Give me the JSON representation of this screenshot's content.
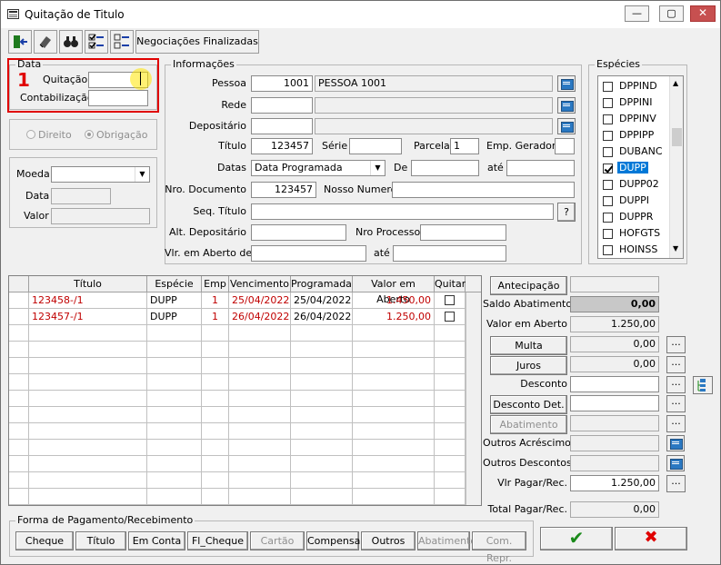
{
  "window": {
    "title": "Quitação de Titulo",
    "minimize": "—",
    "maximize": "▢",
    "close": "✕"
  },
  "toolbar": {
    "negociacoes_label": "Negociações Finalizadas"
  },
  "annotation": {
    "step": "1"
  },
  "data_group": {
    "caption": "Data",
    "quitacao_label": "Quitação",
    "quitacao_value": "",
    "contabilizacao_label": "Contabilização",
    "contabilizacao_value": ""
  },
  "tipo": {
    "direito": "Direito",
    "obrigacao": "Obrigação",
    "selected": "Obrigação"
  },
  "moeda": {
    "moeda_label": "Moeda",
    "moeda_value": "",
    "data_label": "Data",
    "data_value": "",
    "valor_label": "Valor",
    "valor_value": ""
  },
  "info": {
    "caption": "Informações",
    "pessoa_label": "Pessoa",
    "pessoa_code": "1001",
    "pessoa_name": "PESSOA 1001",
    "rede_label": "Rede",
    "rede_code": "",
    "rede_name": "",
    "depositario_label": "Depositário",
    "depositario_code": "",
    "depositario_name": "",
    "titulo_label": "Título",
    "titulo_value": "123457",
    "serie_label": "Série",
    "serie_value": "",
    "parcela_label": "Parcela",
    "parcela_value": "1",
    "emp_geradora_label": "Emp. Geradora",
    "emp_geradora_value": "",
    "datas_label": "Datas",
    "datas_value": "Data Programada",
    "de_label": "De",
    "de_value": "",
    "ate_label": "até",
    "ate_value": "",
    "nro_documento_label": "Nro. Documento",
    "nro_documento_value": "123457",
    "nosso_numero_label": "Nosso Numero",
    "nosso_numero_value": "",
    "seq_titulo_label": "Seq. Título",
    "seq_titulo_value": "",
    "help": "?",
    "alt_depositario_label": "Alt. Depositário",
    "alt_depositario_value": "",
    "nro_processo_label": "Nro Processo",
    "nro_processo_value": "",
    "vlr_aberto_de_label": "Vlr. em Aberto de",
    "vlr_aberto_de_value": "",
    "vlr_aberto_ate_label": "até",
    "vlr_aberto_ate_value": ""
  },
  "especies": {
    "caption": "Espécies",
    "items": [
      {
        "label": "DPPIND",
        "checked": false
      },
      {
        "label": "DPPINI",
        "checked": false
      },
      {
        "label": "DPPINV",
        "checked": false
      },
      {
        "label": "DPPIPP",
        "checked": false
      },
      {
        "label": "DUBANC",
        "checked": false
      },
      {
        "label": "DUPP",
        "checked": true
      },
      {
        "label": "DUPP02",
        "checked": false
      },
      {
        "label": "DUPPI",
        "checked": false
      },
      {
        "label": "DUPPR",
        "checked": false
      },
      {
        "label": "HOFGTS",
        "checked": false
      },
      {
        "label": "HOINSS",
        "checked": false
      }
    ]
  },
  "grid": {
    "headers": [
      "Título",
      "Espécie",
      "Emp",
      "Vencimento",
      "Programada",
      "Valor em Aberto",
      "Quitar"
    ],
    "rows": [
      {
        "titulo": "123458-/1",
        "especie": "DUPP",
        "emp": "1",
        "vencimento": "25/04/2022",
        "programada": "25/04/2022",
        "valor": "1.450,00",
        "quitar": false
      },
      {
        "titulo": "123457-/1",
        "especie": "DUPP",
        "emp": "1",
        "vencimento": "26/04/2022",
        "programada": "26/04/2022",
        "valor": "1.250,00",
        "quitar": false
      }
    ]
  },
  "totals": {
    "antecipacao_label": "Antecipação",
    "antecipacao_value": "",
    "saldo_abatimento_label": "Saldo Abatimento",
    "saldo_abatimento_value": "0,00",
    "valor_aberto_label": "Valor em Aberto",
    "valor_aberto_value": "1.250,00",
    "multa_label": "Multa",
    "multa_value": "0,00",
    "juros_label": "Juros",
    "juros_value": "0,00",
    "desconto_label": "Desconto",
    "desconto_value": "",
    "desconto_det_label": "Desconto Det.",
    "desconto_det_value": "",
    "abatimento_label": "Abatimento",
    "abatimento_value": "",
    "outros_acrescimos_label": "Outros Acréscimos",
    "outros_acrescimos_value": "",
    "outros_descontos_label": "Outros Descontos",
    "outros_descontos_value": "",
    "vlr_pagar_label": "Vlr Pagar/Rec.",
    "vlr_pagar_value": "1.250,00",
    "total_pagar_label": "Total Pagar/Rec.",
    "total_pagar_value": "0,00",
    "ellipsis": "..."
  },
  "pagamento": {
    "caption": "Forma de Pagamento/Recebimento",
    "buttons": [
      "Cheque",
      "Título",
      "Em Conta",
      "Fl_Cheque",
      "Cartão",
      "Compensar",
      "Outros",
      "Abatimento",
      "Com. Repr."
    ]
  },
  "actions": {
    "ok_symbol": "✔",
    "cancel_symbol": "✖",
    "ok_color": "#1a8a1a",
    "cancel_color": "#e00000"
  }
}
